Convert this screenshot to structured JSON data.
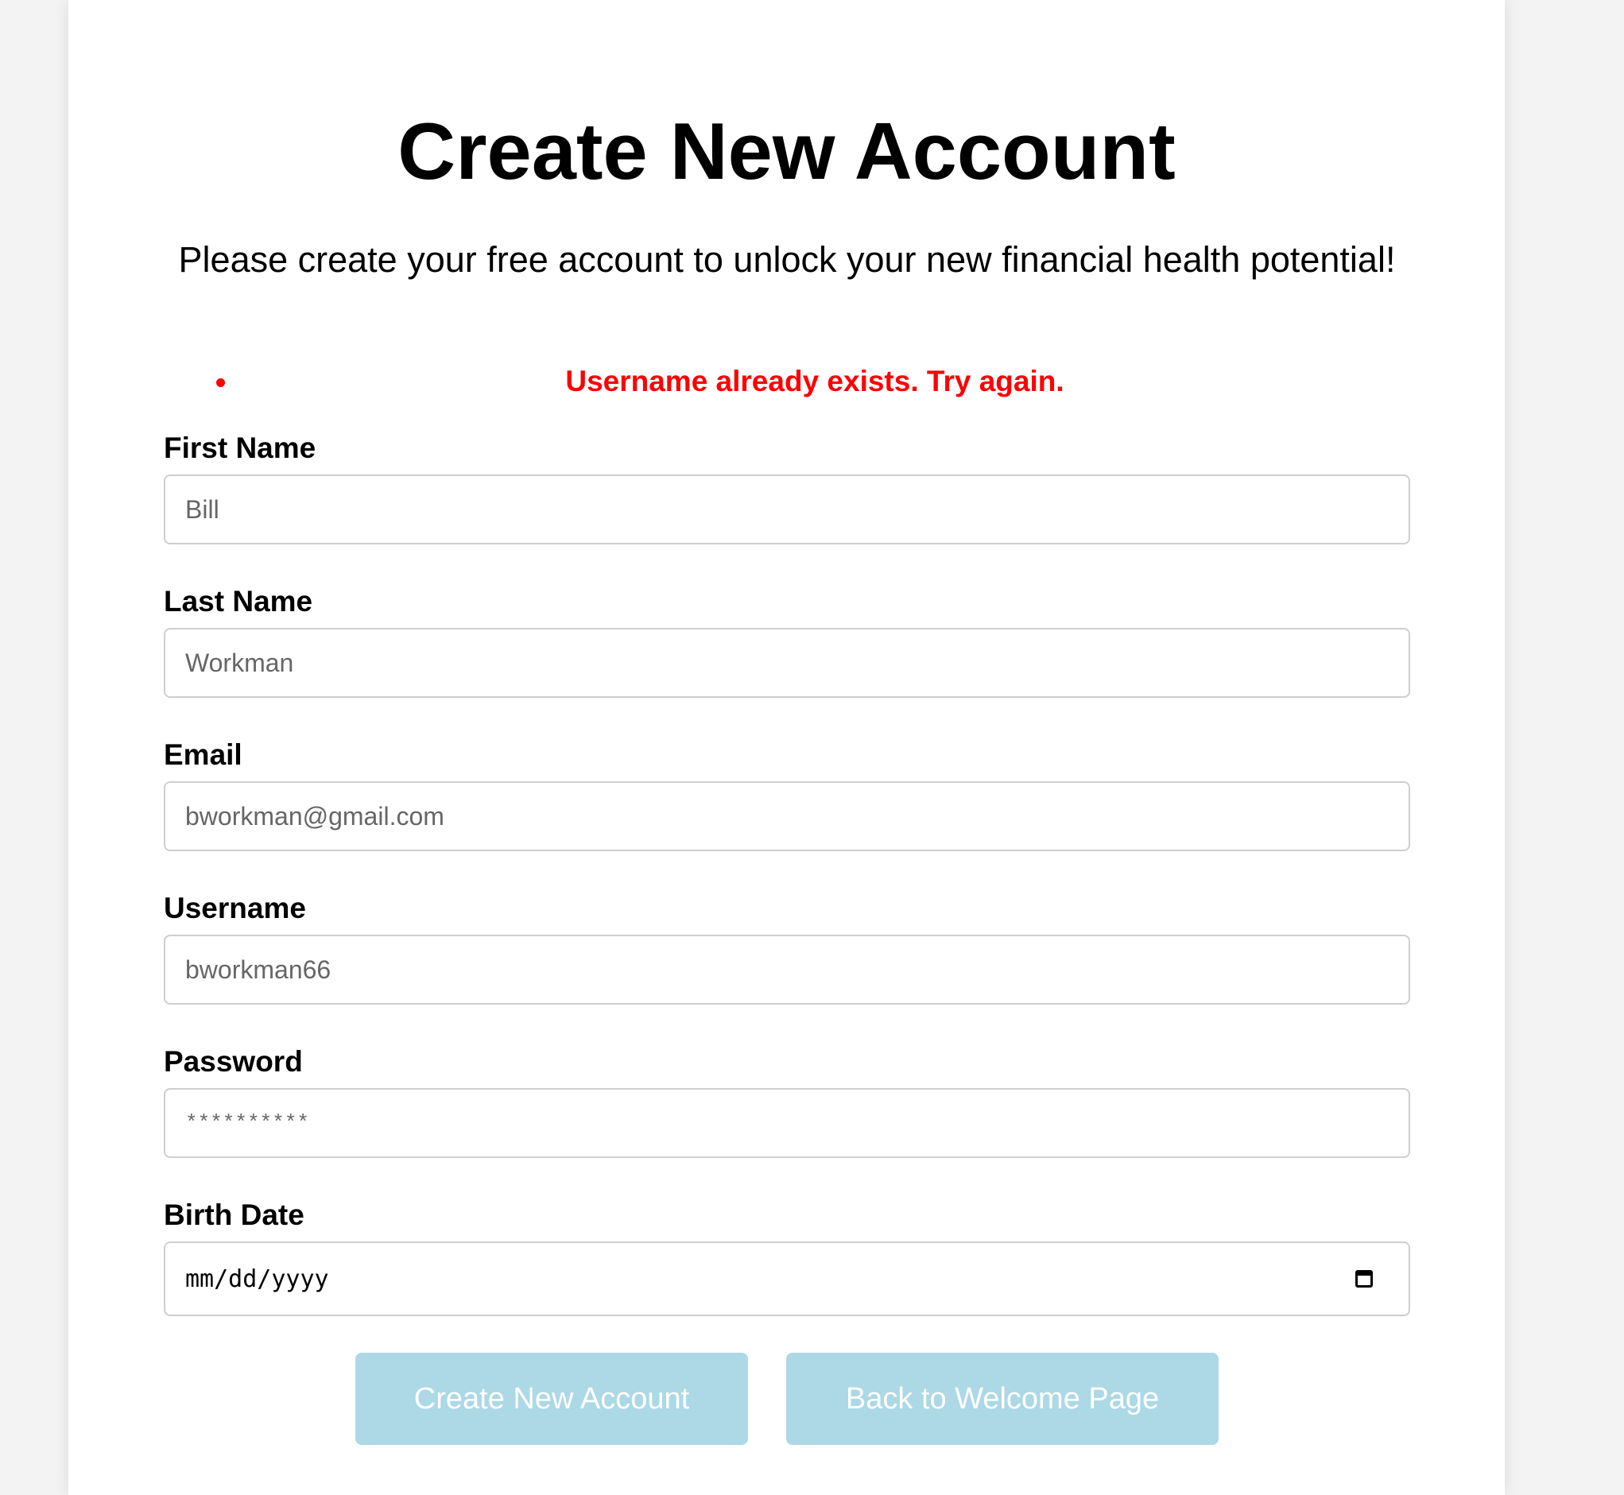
{
  "page": {
    "title": "Create New Account",
    "subtitle": "Please create your free account to unlock your new financial health potential!",
    "errors": [
      "Username already exists. Try again."
    ]
  },
  "form": {
    "first_name": {
      "label": "First Name",
      "value": "Bill"
    },
    "last_name": {
      "label": "Last Name",
      "value": "Workman"
    },
    "email": {
      "label": "Email",
      "value": "bworkman@gmail.com"
    },
    "username": {
      "label": "Username",
      "value": "bworkman66"
    },
    "password": {
      "label": "Password",
      "value": "**********"
    },
    "birth_date": {
      "label": "Birth Date",
      "placeholder": "mm/dd/yyyy"
    }
  },
  "buttons": {
    "create": "Create New Account",
    "back": "Back to Welcome Page"
  },
  "colors": {
    "error": "#ff0000",
    "button_bg": "#add8e6",
    "button_text": "#ffffff",
    "page_bg": "#f3f3f3"
  },
  "icons": {
    "error_bullet": "bullet-icon",
    "date_picker": "calendar-icon"
  }
}
